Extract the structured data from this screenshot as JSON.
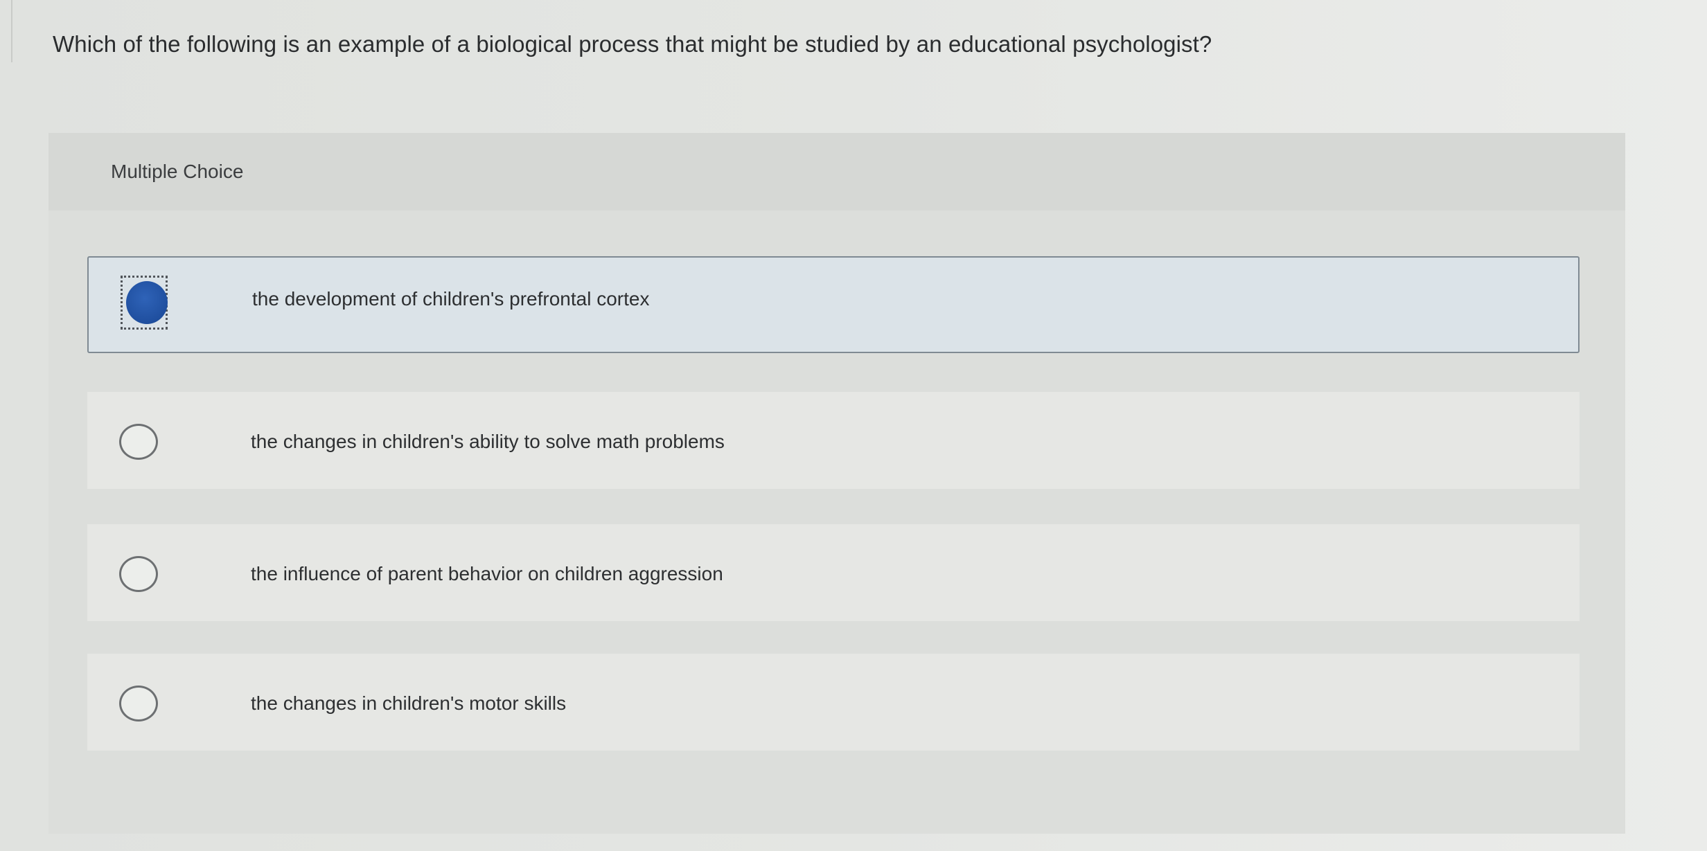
{
  "question": {
    "text": "Which of the following is an example of a biological process that might be studied by an educational psychologist?"
  },
  "panel": {
    "header_label": "Multiple Choice"
  },
  "options": [
    {
      "label": "the development of children's prefrontal cortex",
      "selected": true
    },
    {
      "label": "the changes in children's ability to solve math problems",
      "selected": false
    },
    {
      "label": "the influence of parent behavior on children aggression",
      "selected": false
    },
    {
      "label": "the changes in children's motor skills",
      "selected": false
    }
  ],
  "colors": {
    "selected_radio": "#1f4f9f",
    "selected_background": "#dbe3e8",
    "option_background": "#e6e7e4",
    "panel_background": "#dcdedb"
  }
}
